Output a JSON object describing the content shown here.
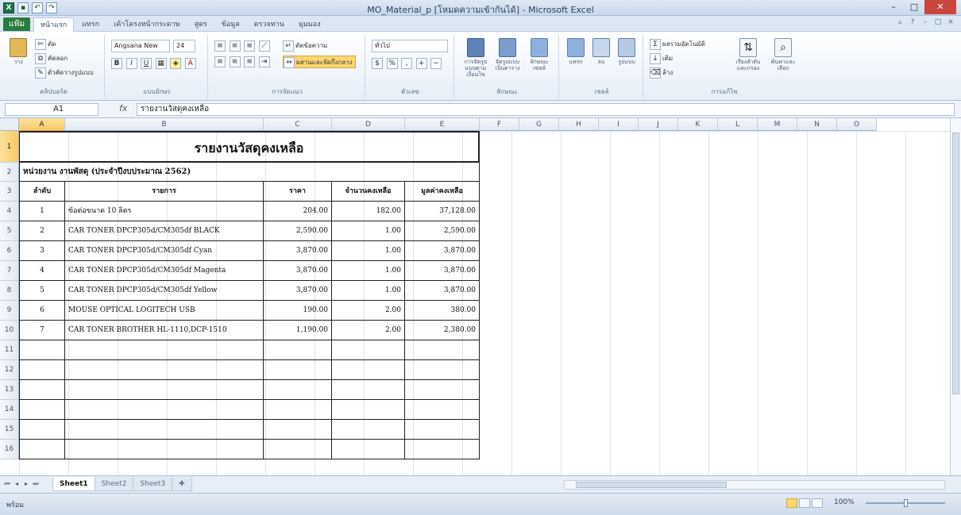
{
  "window": {
    "title": "MO_Material_p [โหมดความเข้ากันได้] - Microsoft Excel"
  },
  "ribbon": {
    "file_tab": "แฟ้ม",
    "tabs": [
      "หน้าแรก",
      "แทรก",
      "เค้าโครงหน้ากระดาษ",
      "สูตร",
      "ข้อมูล",
      "ตรวจทาน",
      "มุมมอง"
    ],
    "clipboard": {
      "paste": "วาง",
      "cut": "ตัด",
      "copy": "คัดลอก",
      "format_painter": "ตัวคัดวางรูปแบบ",
      "label": "คลิปบอร์ด"
    },
    "font": {
      "name": "Angsana New",
      "size": "24",
      "label": "แบบอักษร"
    },
    "alignment": {
      "wrap": "ตัดข้อความ",
      "merge": "ผสานและจัดกึ่งกลาง",
      "label": "การจัดแนว"
    },
    "number": {
      "format": "ทั่วไป",
      "label": "ตัวเลข"
    },
    "styles": {
      "conditional": "การจัดรูปแบบตามเงื่อนไข",
      "table": "จัดรูปแบบเป็นตาราง",
      "cell": "ลักษณะเซลล์",
      "label": "ลักษณะ"
    },
    "cells": {
      "insert": "แทรก",
      "delete": "ลบ",
      "format": "รูปแบบ",
      "label": "เซลล์"
    },
    "editing": {
      "autosum": "ผลรวมอัตโนมัติ",
      "fill": "เติม",
      "clear": "ล้าง",
      "sort": "เรียงลำดับและกรอง",
      "find": "ค้นหาและเลือก",
      "label": "การแก้ไข"
    }
  },
  "formula_bar": {
    "name_box": "A1",
    "fx": "fx",
    "value": "รายงานวัสดุคงเหลือ"
  },
  "columns": [
    "A",
    "B",
    "C",
    "D",
    "E",
    "F",
    "G",
    "H",
    "I",
    "J",
    "K",
    "L",
    "M",
    "N",
    "O"
  ],
  "rows": [
    "1",
    "2",
    "3",
    "4",
    "5",
    "6",
    "7",
    "8",
    "9",
    "10",
    "11",
    "12",
    "13",
    "14",
    "15",
    "16"
  ],
  "sheet": {
    "title": "รายงานวัสดุคงเหลือ",
    "subtitle": "หน่วยงาน งานพัสดุ (ประจำปีงบประมาณ 2562)",
    "headers": [
      "ลำดับ",
      "รายการ",
      "ราคา",
      "จำนวนคงเหลือ",
      "มูลค่าคงเหลือ"
    ],
    "items": [
      [
        "1",
        "ข้อต่อขนาด 10 ลิตร",
        "204.00",
        "182.00",
        "37,128.00"
      ],
      [
        "2",
        "CAR TONER DPCP305d/CM305df BLACK",
        "2,590.00",
        "1.00",
        "2,590.00"
      ],
      [
        "3",
        "CAR TONER DPCP305d/CM305df Cyan",
        "3,870.00",
        "1.00",
        "3,870.00"
      ],
      [
        "4",
        "CAR TONER DPCP305d/CM305df Magenta",
        "3,870.00",
        "1.00",
        "3,870.00"
      ],
      [
        "5",
        "CAR TONER DPCP305d/CM305df Yellow",
        "3,870.00",
        "1.00",
        "3,870.00"
      ],
      [
        "6",
        "MOUSE OPTICAL LOGITECH USB",
        "190.00",
        "2.00",
        "380.00"
      ],
      [
        "7",
        "CAR TONER BROTHER HL-1110,DCP-1510",
        "1,190.00",
        "2.00",
        "2,380.00"
      ]
    ]
  },
  "sheet_tabs": [
    "Sheet1",
    "Sheet2",
    "Sheet3"
  ],
  "status": {
    "text": "พร้อม",
    "zoom": "100%"
  }
}
